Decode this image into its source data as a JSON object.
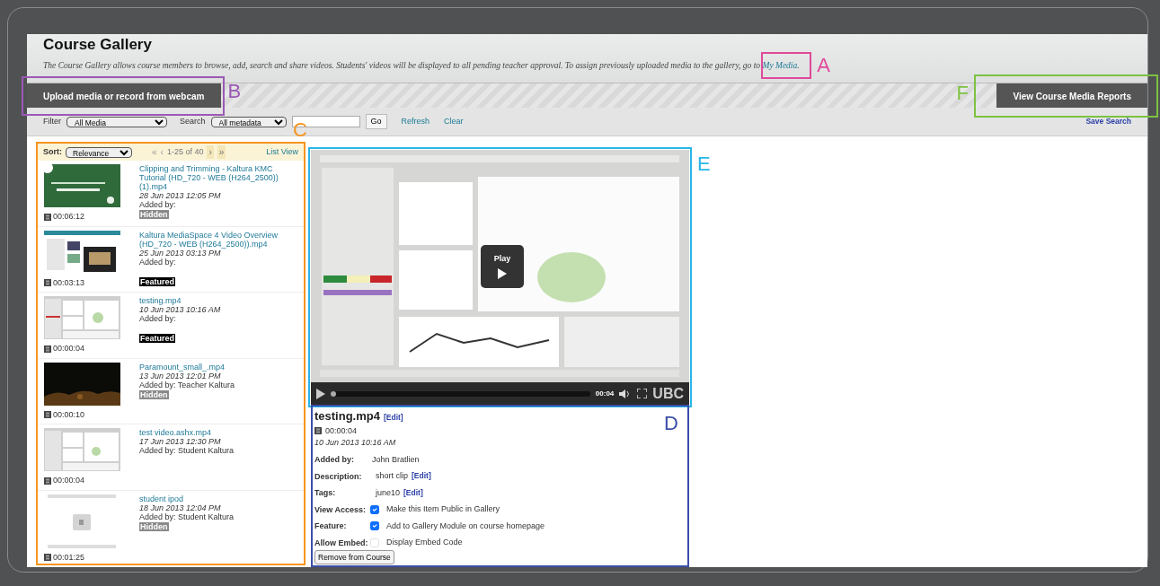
{
  "header": {
    "title": "Course Gallery",
    "description": "The Course Gallery allows course members to browse, add, search and share videos. Students' videos will be displayed to all pending teacher approval.  To assign previously uploaded media to the gallery, go to",
    "link": "My Media",
    "after_link": "."
  },
  "toolbar": {
    "upload_button": "Upload media or record from webcam",
    "reports_button": "View Course Media Reports"
  },
  "filter_bar": {
    "filter_label": "Filter",
    "filter_value": "All Media",
    "search_label": "Search",
    "search_scope": "All metadata",
    "search_button": "Go",
    "links": [
      "Refresh",
      "Clear"
    ],
    "save_search": "Save Search"
  },
  "list": {
    "sort_label": "Sort:",
    "sort_value": "Relevance",
    "pager_back": [
      {
        "label": "«",
        "disabled": true
      },
      {
        "label": "‹",
        "disabled": true
      }
    ],
    "range": "1-25 of 40",
    "pager_next": [
      {
        "label": "›",
        "disabled": false
      },
      {
        "label": "»",
        "disabled": false
      }
    ],
    "view_link": "List View",
    "items": [
      {
        "title": "Clipping and Trimming - Kaltura KMC Tutorial (HD_720 - WEB (H264_2500)) (1).mp4",
        "date": "28 Jun 2013 12:05 PM",
        "added_by": "Added by:",
        "badge": {
          "text": "Hidden",
          "kind": "hidden"
        },
        "duration": "00:06:12"
      },
      {
        "title": "Kaltura MediaSpace 4 Video Overview (HD_720 - WEB (H264_2500)).mp4",
        "date": "25 Jun 2013 03:13 PM",
        "added_by": "Added by:",
        "badge": {
          "text": "Featured",
          "kind": "featured"
        },
        "duration": "00:03:13"
      },
      {
        "title": "testing.mp4",
        "date": "10 Jun 2013 10:16 AM",
        "added_by": "Added by:",
        "badge": {
          "text": "Featured",
          "kind": "featured"
        },
        "duration": "00:00:04"
      },
      {
        "title": "Paramount_small_.mp4",
        "date": "13 Jun 2013 12:01 PM",
        "added_by": "Added by: Teacher Kaltura",
        "badge": {
          "text": "Hidden",
          "kind": "hidden"
        },
        "duration": "00:00:10"
      },
      {
        "title": "test video.ashx.mp4",
        "date": "17 Jun 2013 12:30 PM",
        "added_by": "Added by: Student Kaltura",
        "duration": "00:00:04"
      },
      {
        "title": "student ipod",
        "date": "18 Jun 2013 12:04 PM",
        "added_by": "Added by: Student Kaltura",
        "badge": {
          "text": "Hidden",
          "kind": "hidden"
        },
        "duration": "00:01:25"
      }
    ]
  },
  "player": {
    "play_label": "Play",
    "time": "00:04",
    "level": 0.02,
    "logo": "UBC"
  },
  "details": {
    "title": "testing.mp4",
    "title_edit": "[Edit]",
    "duration": "00:00:04",
    "date": "10 Jun 2013 10:16 AM",
    "fields": [
      {
        "kind": "text",
        "label": "Added by:",
        "value": "John Bratlien"
      },
      {
        "kind": "text",
        "label": "Description:",
        "value": "short clip",
        "edit": "[Edit]"
      },
      {
        "kind": "text",
        "label": "Tags:",
        "value": "june10",
        "edit": "[Edit]"
      },
      {
        "kind": "check",
        "label": "View Access:",
        "checked": true,
        "value": "Make this Item Public in Gallery"
      },
      {
        "kind": "check",
        "label": "Feature:",
        "checked": true,
        "value": "Add to Gallery Module on course homepage"
      },
      {
        "kind": "check",
        "label": "Allow Embed:",
        "checked": false,
        "value": "Display Embed Code"
      }
    ],
    "button": "Remove from Course"
  },
  "callouts": [
    {
      "letter": "A",
      "color": "#e0489a"
    },
    {
      "letter": "B",
      "color": "#9b59b6"
    },
    {
      "letter": "F",
      "color": "#7cc242"
    },
    {
      "letter": "C",
      "color": "#f7941d"
    },
    {
      "letter": "E",
      "color": "#29b6e8"
    },
    {
      "letter": "D",
      "color": "#3b4ea8"
    }
  ]
}
